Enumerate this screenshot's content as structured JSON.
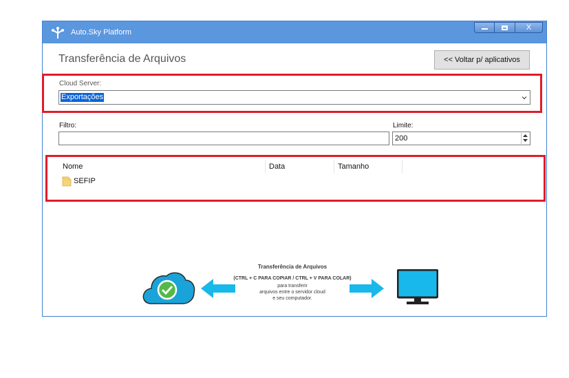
{
  "window": {
    "app_title": "Auto.Sky Platform",
    "close_glyph": "X"
  },
  "header": {
    "page_title": "Transferência de Arquivos",
    "back_button_label": "<< Voltar p/ aplicativos"
  },
  "cloud_server": {
    "label": "Cloud Server:",
    "selected": "Exportações"
  },
  "filter": {
    "filtro_label": "Filtro:",
    "filtro_value": "",
    "limite_label": "Limite:",
    "limite_value": "200"
  },
  "file_list": {
    "columns": [
      "Nome",
      "Data",
      "Tamanho"
    ],
    "rows": [
      {
        "name": "SEFIP",
        "icon": "folder-icon"
      }
    ]
  },
  "banner": {
    "title": "Transferência de Arquivos",
    "shortcut": "(CTRL + C PARA COPIAR / CTRL + V PARA COLAR)",
    "line1": "para transferir",
    "line2": "arquivos entre o servidor cloud",
    "line3": "e seu computador."
  },
  "colors": {
    "titlebar": "#5a97df",
    "highlight": "#e01b2a",
    "selection": "#0a64d6",
    "cloud": "#1aa3d8",
    "check": "#55b947",
    "monitor": "#19b8ea"
  },
  "icons": [
    "app-logo-icon",
    "chevron-down-icon",
    "folder-icon",
    "cloud-check-icon",
    "arrow-left-icon",
    "arrow-right-icon",
    "monitor-icon"
  ]
}
